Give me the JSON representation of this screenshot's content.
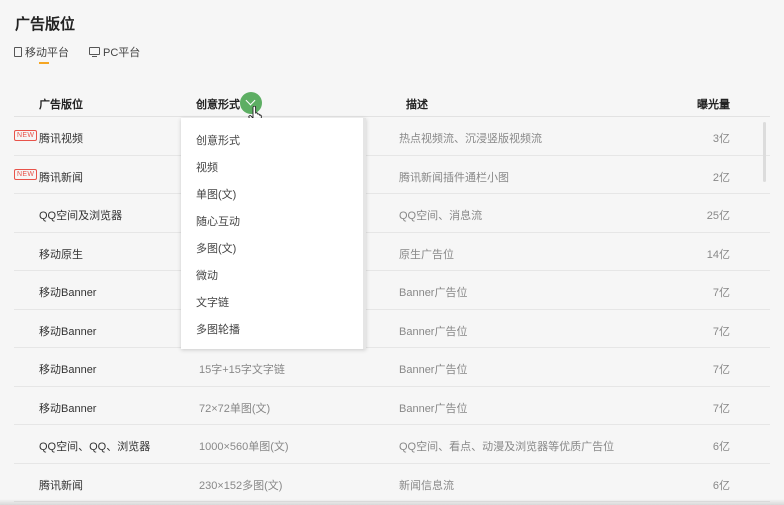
{
  "page": {
    "title": "广告版位"
  },
  "platform_tabs": [
    {
      "label": "移动平台",
      "icon": "phone-icon",
      "active": true
    },
    {
      "label": "PC平台",
      "icon": "monitor-icon",
      "active": false
    }
  ],
  "table": {
    "headers": {
      "placement": "广告版位",
      "format": "创意形式",
      "description": "描述",
      "exposure": "曝光量"
    },
    "rows": [
      {
        "badge": "NEW",
        "placement": "腾讯视频",
        "format": "",
        "description": "热点视频流、沉浸竖版视频流",
        "exposure": "3亿"
      },
      {
        "badge": "NEW",
        "placement": "腾讯新闻",
        "format": "",
        "description": "腾讯新闻插件通栏小图",
        "exposure": "2亿"
      },
      {
        "badge": "",
        "placement": "QQ空间及浏览器",
        "format": "",
        "description": "QQ空间、消息流",
        "exposure": "25亿"
      },
      {
        "badge": "",
        "placement": "移动原生",
        "format": "",
        "description": "原生广告位",
        "exposure": "14亿"
      },
      {
        "badge": "",
        "placement": "移动Banner",
        "format": "",
        "description": "Banner广告位",
        "exposure": "7亿"
      },
      {
        "badge": "",
        "placement": "移动Banner",
        "format": "",
        "description": "Banner广告位",
        "exposure": "7亿"
      },
      {
        "badge": "",
        "placement": "移动Banner",
        "format": "15字+15字文字链",
        "description": "Banner广告位",
        "exposure": "7亿"
      },
      {
        "badge": "",
        "placement": "移动Banner",
        "format": "72×72单图(文)",
        "description": "Banner广告位",
        "exposure": "7亿"
      },
      {
        "badge": "",
        "placement": "QQ空间、QQ、浏览器",
        "format": "1000×560单图(文)",
        "description": "QQ空间、看点、动漫及浏览器等优质广告位",
        "exposure": "6亿"
      },
      {
        "badge": "",
        "placement": "腾讯新闻",
        "format": "230×152多图(文)",
        "description": "新闻信息流",
        "exposure": "6亿"
      }
    ]
  },
  "format_dropdown": {
    "items": [
      "创意形式",
      "视频",
      "单图(文)",
      "随心互动",
      "多图(文)",
      "微动",
      "文字链",
      "多图轮播"
    ]
  },
  "colors": {
    "accent": "#f5a623",
    "sort_button": "#5dae63",
    "new_badge": "#e8534a"
  }
}
